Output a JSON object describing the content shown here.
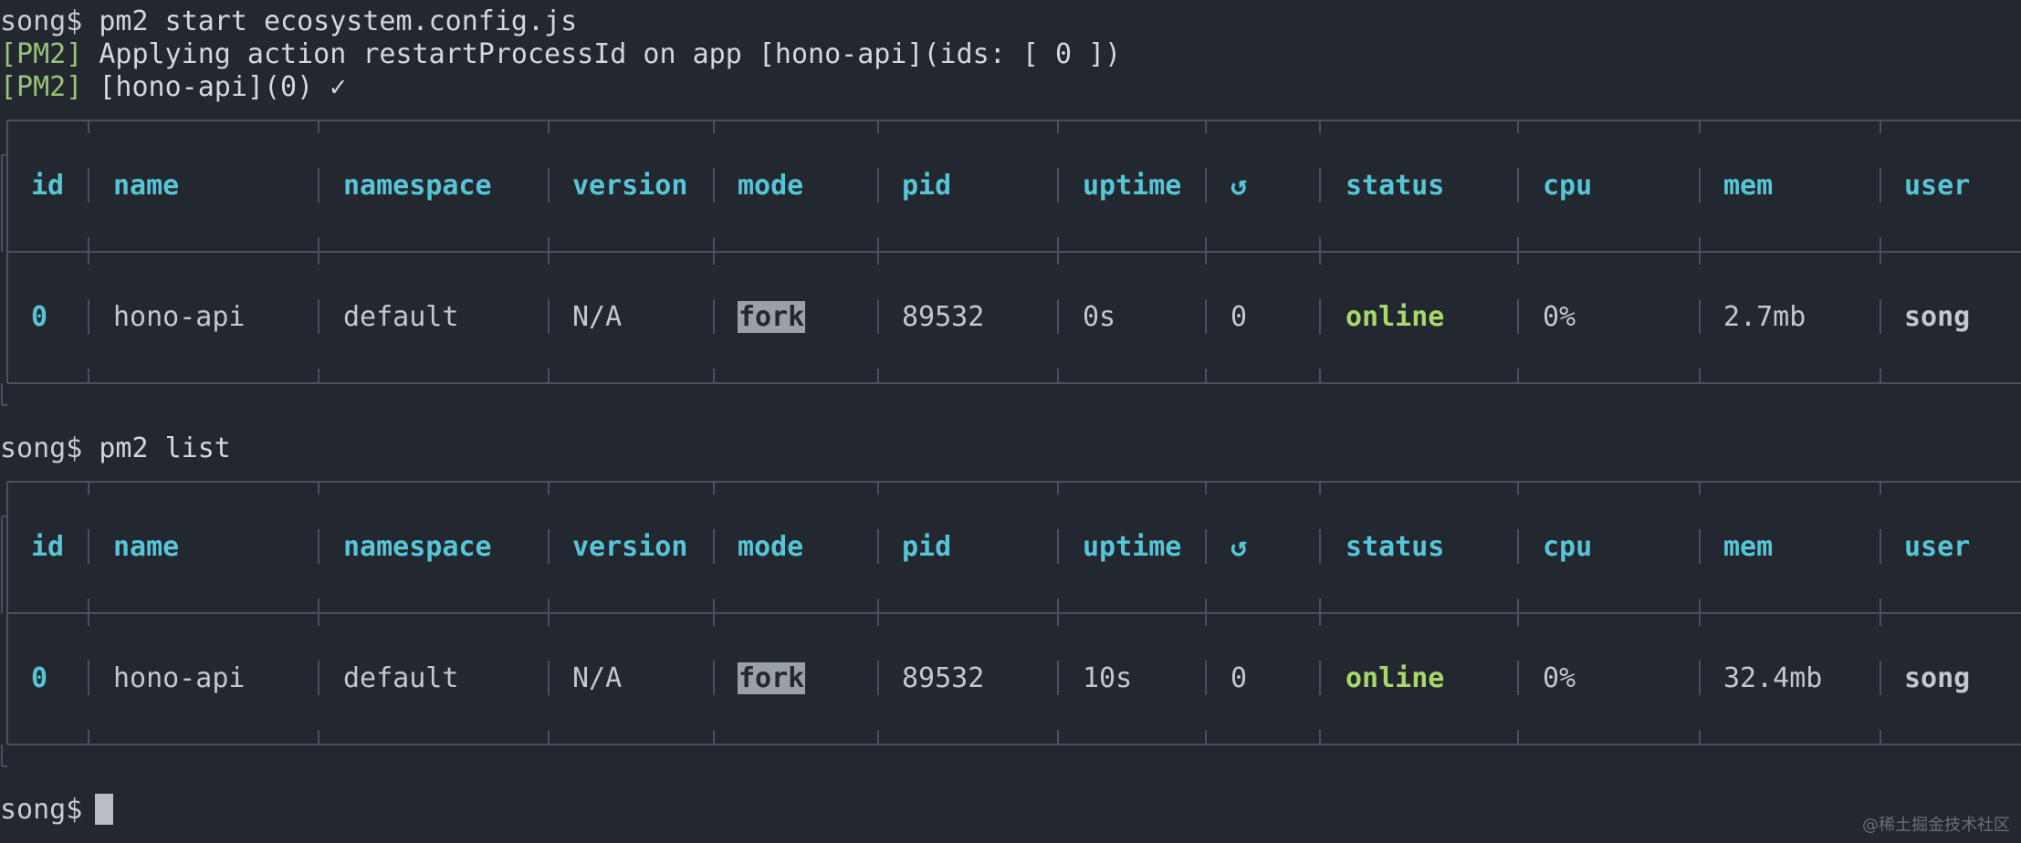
{
  "lines": {
    "cmd1_prompt": "song$ ",
    "cmd1_text": "pm2 start ecosystem.config.js",
    "log1_tag": "[PM2]",
    "log1_text": " Applying action restartProcessId on app [hono-api](ids: [ 0 ])",
    "log2_tag": "[PM2]",
    "log2_text": " [hono-api](0) ✓",
    "cmd2_prompt": "song$ ",
    "cmd2_text": "pm2 list",
    "cmd3_prompt": "song$ "
  },
  "headers": [
    "id",
    "name",
    "namespace",
    "version",
    "mode",
    "pid",
    "uptime",
    "↺",
    "status",
    "cpu",
    "mem",
    "user"
  ],
  "table1": {
    "row": [
      "0",
      "hono-api",
      "default",
      "N/A",
      "fork",
      "89532",
      "0s",
      "0",
      "online",
      "0%",
      "2.7mb",
      "song"
    ]
  },
  "table2": {
    "row": [
      "0",
      "hono-api",
      "default",
      "N/A",
      "fork",
      "89532",
      "10s",
      "0",
      "online",
      "0%",
      "32.4mb",
      "song"
    ]
  },
  "watermark": "@稀土掘金技术社区",
  "colors": {
    "background": "#23272f",
    "header": "#56c6d6",
    "online": "#a8d86a",
    "pm2_tag": "#98c379",
    "border": "#4b515b"
  }
}
